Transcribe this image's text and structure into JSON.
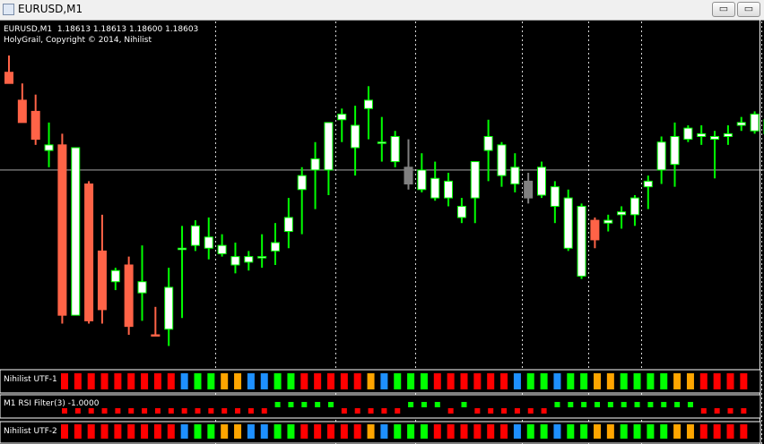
{
  "window": {
    "title": "EURUSD,M1",
    "minimize_label": "▭",
    "maximize_label": "▭"
  },
  "chart_header": {
    "symbol_line": "EURUSD,M1  1.18613 1.18613 1.18600 1.18603",
    "indicator_line": "HolyGrail, Copyright © 2014, Nihilist"
  },
  "panels": {
    "utf1_label": "Nihilist UTF-1",
    "rsi_label": "M1 RSI Filter(3) -1.0000",
    "utf2_label": "Nihilist UTF-2"
  },
  "colors": {
    "background": "#000000",
    "bull_body": "#ffffff",
    "bull_outline": "#00ff00",
    "bear": "#ff6347",
    "neutral": "#808080",
    "up_strong": "#00ff00",
    "down": "#ff0000",
    "dark_red": "#b22222",
    "orange": "#ffa500",
    "blue": "#1e90ff",
    "grid": "#c0c0c0"
  },
  "chart_data": {
    "type": "candlestick",
    "symbol": "EURUSD",
    "timeframe": "M1",
    "last_bar": {
      "open": 1.18613,
      "high": 1.18613,
      "low": 1.186,
      "close": 1.18603
    },
    "candles": [
      {
        "o": 0.94,
        "h": 1.0,
        "l": 0.9,
        "c": 0.9,
        "t": "bear"
      },
      {
        "o": 0.84,
        "h": 0.9,
        "l": 0.76,
        "c": 0.76,
        "t": "bear"
      },
      {
        "o": 0.8,
        "h": 0.86,
        "l": 0.68,
        "c": 0.7,
        "t": "bear"
      },
      {
        "o": 0.66,
        "h": 0.76,
        "l": 0.6,
        "c": 0.68,
        "t": "bull"
      },
      {
        "o": 0.68,
        "h": 0.72,
        "l": 0.04,
        "c": 0.07,
        "t": "bear"
      },
      {
        "o": 0.67,
        "h": 0.67,
        "l": 0.07,
        "c": 0.07,
        "t": "bull"
      },
      {
        "o": 0.54,
        "h": 0.55,
        "l": 0.04,
        "c": 0.05,
        "t": "bear"
      },
      {
        "o": 0.3,
        "h": 0.43,
        "l": 0.04,
        "c": 0.09,
        "t": "bear"
      },
      {
        "o": 0.19,
        "h": 0.24,
        "l": 0.16,
        "c": 0.23,
        "t": "bull"
      },
      {
        "o": 0.25,
        "h": 0.28,
        "l": 0.0,
        "c": 0.03,
        "t": "bear"
      },
      {
        "o": 0.19,
        "h": 0.32,
        "l": 0.05,
        "c": 0.15,
        "t": "bull"
      },
      {
        "o": 0.0,
        "h": 0.1,
        "l": 0.0,
        "c": 0.0,
        "t": "bear"
      },
      {
        "o": 0.17,
        "h": 0.24,
        "l": -0.04,
        "c": 0.02,
        "t": "bull"
      },
      {
        "o": 0.31,
        "h": 0.39,
        "l": 0.06,
        "c": 0.31,
        "t": "bull"
      },
      {
        "o": 0.39,
        "h": 0.41,
        "l": 0.3,
        "c": 0.32,
        "t": "bull"
      },
      {
        "o": 0.35,
        "h": 0.42,
        "l": 0.27,
        "c": 0.31,
        "t": "bull"
      },
      {
        "o": 0.32,
        "h": 0.36,
        "l": 0.28,
        "c": 0.29,
        "t": "bull"
      },
      {
        "o": 0.28,
        "h": 0.33,
        "l": 0.22,
        "c": 0.25,
        "t": "bull"
      },
      {
        "o": 0.28,
        "h": 0.3,
        "l": 0.23,
        "c": 0.26,
        "t": "bull"
      },
      {
        "o": 0.28,
        "h": 0.36,
        "l": 0.24,
        "c": 0.28,
        "t": "bull"
      },
      {
        "o": 0.33,
        "h": 0.4,
        "l": 0.25,
        "c": 0.3,
        "t": "bull"
      },
      {
        "o": 0.37,
        "h": 0.49,
        "l": 0.31,
        "c": 0.42,
        "t": "bull"
      },
      {
        "o": 0.57,
        "h": 0.6,
        "l": 0.36,
        "c": 0.52,
        "t": "bull"
      },
      {
        "o": 0.63,
        "h": 0.69,
        "l": 0.45,
        "c": 0.59,
        "t": "bull"
      },
      {
        "o": 0.76,
        "h": 0.76,
        "l": 0.5,
        "c": 0.59,
        "t": "bull"
      },
      {
        "o": 0.79,
        "h": 0.81,
        "l": 0.69,
        "c": 0.77,
        "t": "bull"
      },
      {
        "o": 0.75,
        "h": 0.82,
        "l": 0.57,
        "c": 0.67,
        "t": "bull"
      },
      {
        "o": 0.84,
        "h": 0.89,
        "l": 0.7,
        "c": 0.81,
        "t": "bull"
      },
      {
        "o": 0.69,
        "h": 0.78,
        "l": 0.62,
        "c": 0.69,
        "t": "bull"
      },
      {
        "o": 0.71,
        "h": 0.73,
        "l": 0.6,
        "c": 0.62,
        "t": "bull"
      },
      {
        "o": 0.6,
        "h": 0.7,
        "l": 0.52,
        "c": 0.54,
        "t": "neutral"
      },
      {
        "o": 0.59,
        "h": 0.65,
        "l": 0.51,
        "c": 0.52,
        "t": "bull"
      },
      {
        "o": 0.56,
        "h": 0.62,
        "l": 0.48,
        "c": 0.49,
        "t": "bull"
      },
      {
        "o": 0.55,
        "h": 0.58,
        "l": 0.46,
        "c": 0.49,
        "t": "bull"
      },
      {
        "o": 0.46,
        "h": 0.49,
        "l": 0.4,
        "c": 0.42,
        "t": "bull"
      },
      {
        "o": 0.62,
        "h": 0.62,
        "l": 0.4,
        "c": 0.49,
        "t": "bull"
      },
      {
        "o": 0.71,
        "h": 0.77,
        "l": 0.55,
        "c": 0.66,
        "t": "bull"
      },
      {
        "o": 0.68,
        "h": 0.69,
        "l": 0.53,
        "c": 0.57,
        "t": "bull"
      },
      {
        "o": 0.6,
        "h": 0.65,
        "l": 0.51,
        "c": 0.54,
        "t": "bull"
      },
      {
        "o": 0.55,
        "h": 0.58,
        "l": 0.47,
        "c": 0.49,
        "t": "neutral"
      },
      {
        "o": 0.6,
        "h": 0.62,
        "l": 0.49,
        "c": 0.5,
        "t": "bull"
      },
      {
        "o": 0.53,
        "h": 0.55,
        "l": 0.4,
        "c": 0.46,
        "t": "bull"
      },
      {
        "o": 0.49,
        "h": 0.52,
        "l": 0.3,
        "c": 0.31,
        "t": "bull"
      },
      {
        "o": 0.46,
        "h": 0.47,
        "l": 0.2,
        "c": 0.21,
        "t": "bull"
      },
      {
        "o": 0.41,
        "h": 0.42,
        "l": 0.31,
        "c": 0.34,
        "t": "bear"
      },
      {
        "o": 0.41,
        "h": 0.43,
        "l": 0.37,
        "c": 0.4,
        "t": "bull"
      },
      {
        "o": 0.44,
        "h": 0.46,
        "l": 0.38,
        "c": 0.43,
        "t": "bull"
      },
      {
        "o": 0.49,
        "h": 0.5,
        "l": 0.39,
        "c": 0.43,
        "t": "bull"
      },
      {
        "o": 0.55,
        "h": 0.57,
        "l": 0.45,
        "c": 0.53,
        "t": "bull"
      },
      {
        "o": 0.69,
        "h": 0.71,
        "l": 0.54,
        "c": 0.59,
        "t": "bull"
      },
      {
        "o": 0.71,
        "h": 0.76,
        "l": 0.53,
        "c": 0.61,
        "t": "bull"
      },
      {
        "o": 0.74,
        "h": 0.75,
        "l": 0.69,
        "c": 0.7,
        "t": "bull"
      },
      {
        "o": 0.72,
        "h": 0.75,
        "l": 0.68,
        "c": 0.71,
        "t": "bull"
      },
      {
        "o": 0.71,
        "h": 0.73,
        "l": 0.56,
        "c": 0.7,
        "t": "bull"
      },
      {
        "o": 0.72,
        "h": 0.75,
        "l": 0.68,
        "c": 0.71,
        "t": "bull"
      },
      {
        "o": 0.76,
        "h": 0.78,
        "l": 0.73,
        "c": 0.75,
        "t": "bull"
      },
      {
        "o": 0.79,
        "h": 0.8,
        "l": 0.72,
        "c": 0.73,
        "t": "bull"
      },
      {
        "o": 0.77,
        "h": 0.78,
        "l": 0.69,
        "c": 0.72,
        "t": "bull"
      },
      {
        "o": 0.73,
        "h": 0.74,
        "l": 0.58,
        "c": 0.59,
        "t": "bull"
      },
      {
        "o": 0.7,
        "h": 0.71,
        "l": 0.52,
        "c": 0.55,
        "t": "bear"
      },
      {
        "o": 0.64,
        "h": 0.66,
        "l": 0.4,
        "c": 0.45,
        "t": "bear"
      },
      {
        "o": 0.54,
        "h": 0.55,
        "l": 0.32,
        "c": 0.36,
        "t": "bear"
      },
      {
        "o": 0.42,
        "h": 0.48,
        "l": 0.2,
        "c": 0.25,
        "t": "bear"
      },
      {
        "o": 0.25,
        "h": 0.3,
        "l": 0.19,
        "c": 0.24,
        "t": "bull"
      }
    ],
    "vlines_after_candle": [
      15,
      24,
      30,
      38,
      43,
      47,
      56
    ],
    "hline_price": 0.59,
    "utf1": [
      "red",
      "red",
      "red",
      "red",
      "red",
      "red",
      "red",
      "red",
      "red",
      "blue",
      "green",
      "green",
      "orange",
      "orange",
      "blue",
      "blue",
      "green",
      "green",
      "red",
      "red",
      "red",
      "red",
      "red",
      "orange",
      "blue",
      "green",
      "green",
      "green",
      "red",
      "red",
      "red",
      "red",
      "red",
      "red",
      "blue",
      "green",
      "green",
      "blue",
      "green",
      "green",
      "orange",
      "orange",
      "green",
      "green",
      "green",
      "green",
      "orange",
      "orange",
      "red",
      "red",
      "red",
      "red"
    ],
    "rsi": [
      0,
      0,
      0,
      0,
      0,
      0,
      0,
      0,
      0,
      0,
      0,
      0,
      0,
      0,
      0,
      0,
      1,
      1,
      1,
      1,
      1,
      0,
      0,
      0,
      0,
      0,
      1,
      1,
      1,
      0,
      1,
      0,
      0,
      0,
      0,
      0,
      0,
      1,
      1,
      1,
      1,
      1,
      1,
      1,
      1,
      1,
      1,
      1,
      0,
      0,
      0,
      0
    ],
    "utf2": [
      "red",
      "red",
      "red",
      "red",
      "red",
      "red",
      "red",
      "red",
      "red",
      "blue",
      "green",
      "green",
      "orange",
      "orange",
      "blue",
      "blue",
      "green",
      "green",
      "red",
      "red",
      "red",
      "red",
      "red",
      "orange",
      "blue",
      "green",
      "green",
      "green",
      "red",
      "red",
      "red",
      "red",
      "red",
      "red",
      "blue",
      "green",
      "green",
      "blue",
      "green",
      "green",
      "orange",
      "orange",
      "green",
      "green",
      "green",
      "green",
      "orange",
      "orange",
      "red",
      "red",
      "red",
      "red"
    ]
  }
}
